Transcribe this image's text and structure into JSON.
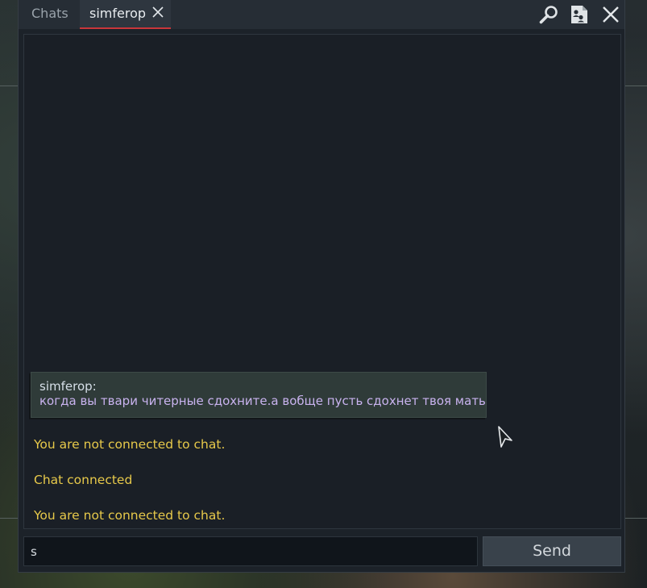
{
  "tabs": {
    "chats_label": "Chats",
    "active_label": "simferop"
  },
  "toolbar": {
    "icons": [
      "search-icon",
      "contacts-icon",
      "close-icon"
    ]
  },
  "chat": {
    "message": {
      "author": "simferop:",
      "text": "когда вы твари читерные сдохните.а вобще пусть сдохнет твоя мать"
    },
    "system_lines": [
      "You are not connected to chat.",
      "Chat connected",
      "You are not connected to chat."
    ]
  },
  "input": {
    "value": "s"
  },
  "send_label": "Send",
  "colors": {
    "window_bg": "#1c2229",
    "tab_active_underline": "#c9363a",
    "system_text": "#e7c94a",
    "message_text": "#c9b3ef",
    "message_bg": "#2f3b39"
  }
}
